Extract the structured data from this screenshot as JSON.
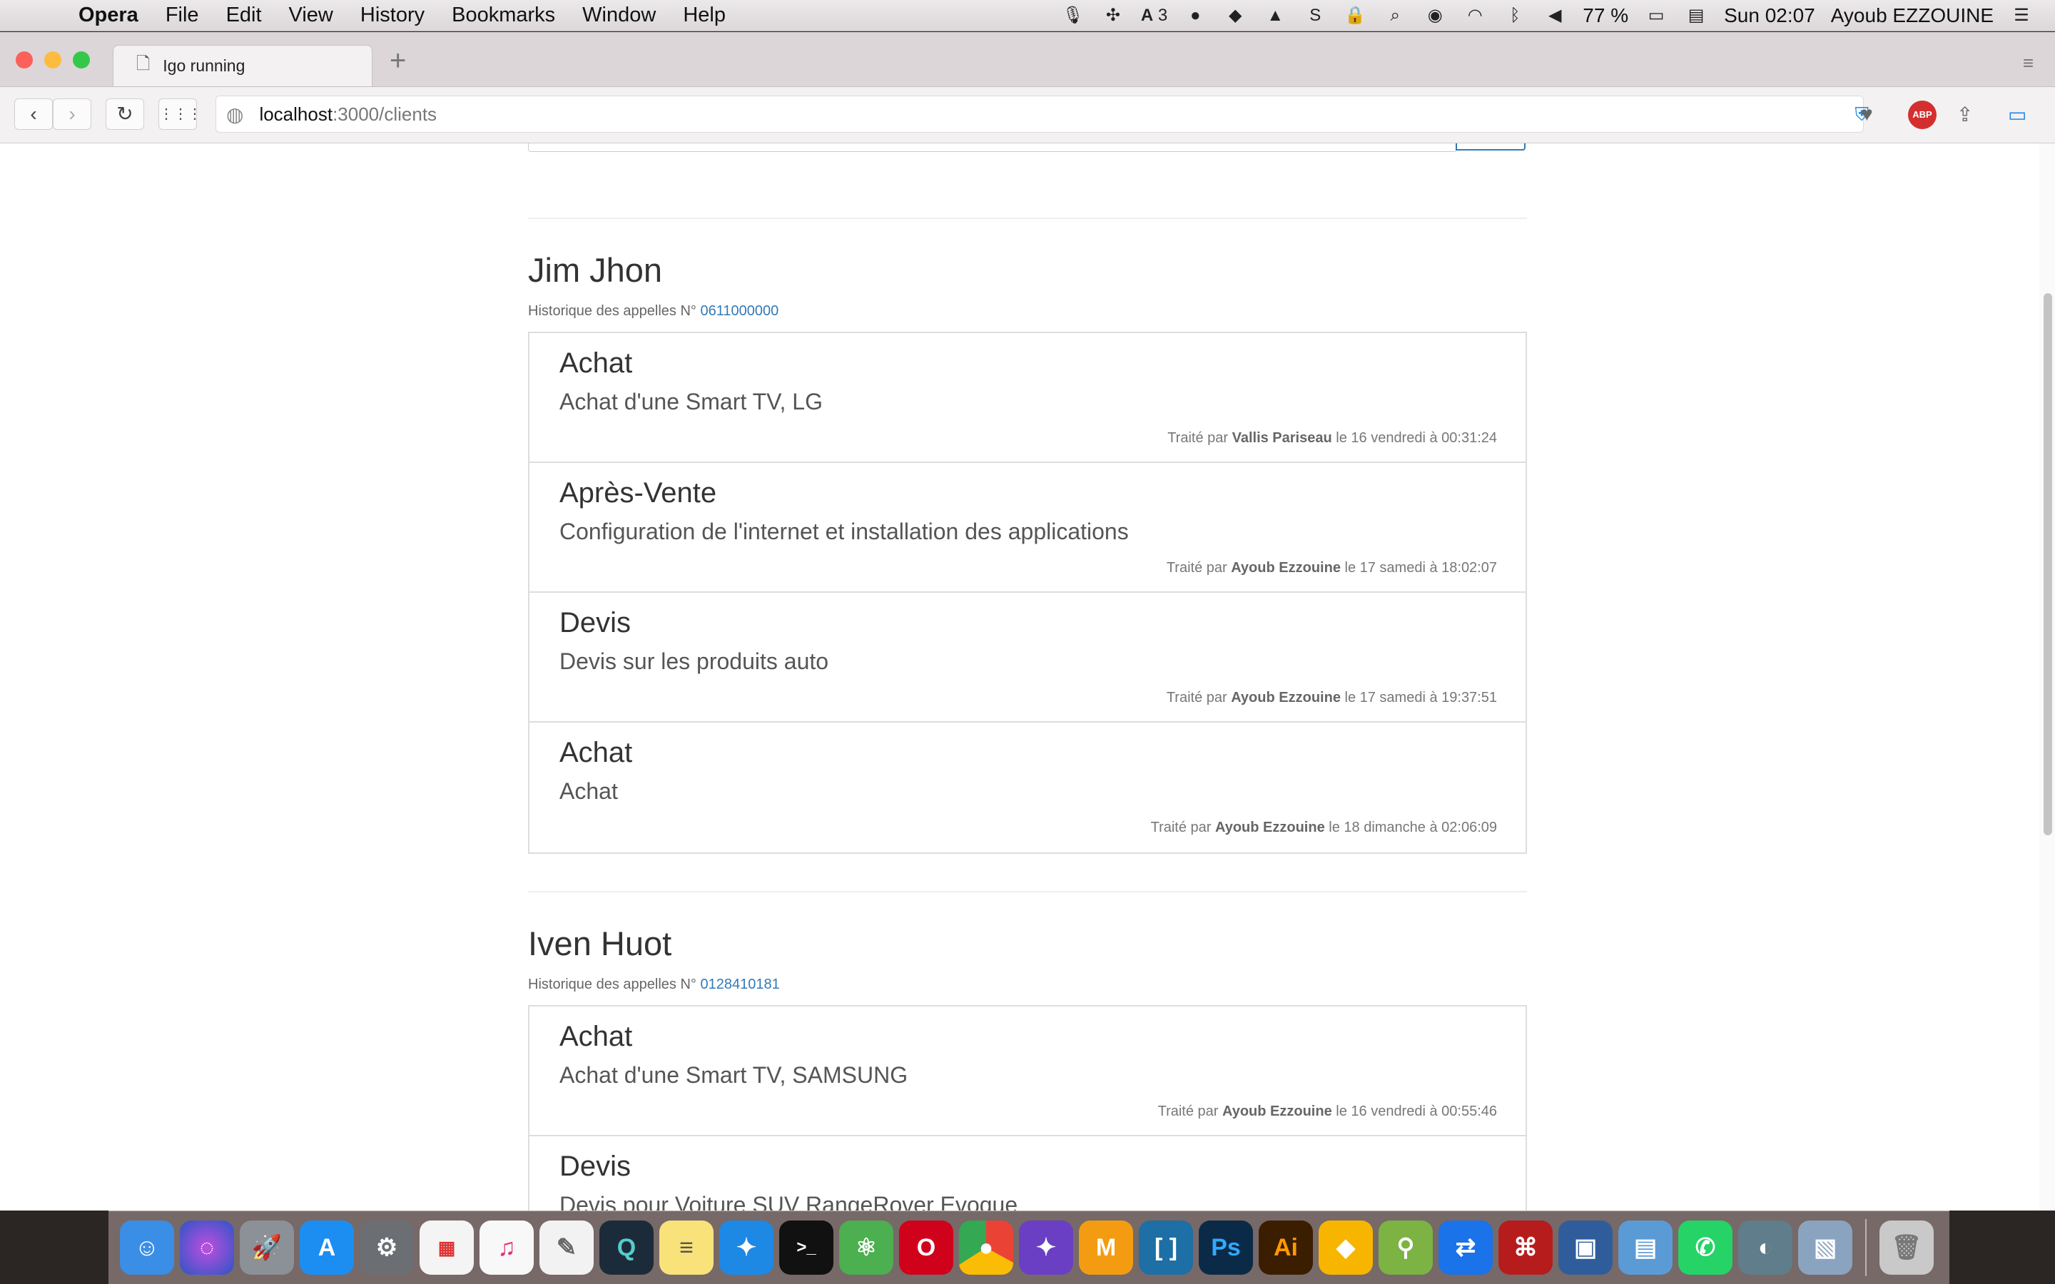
{
  "menubar": {
    "apple": "",
    "app": "Opera",
    "items": [
      "File",
      "Edit",
      "View",
      "History",
      "Bookmarks",
      "Window",
      "Help"
    ],
    "status": {
      "battery": "77 %",
      "clock": "Sun 02:07",
      "user": "Ayoub EZZOUINE",
      "adobe_count": "3"
    }
  },
  "browser": {
    "tab_title": "Igo running",
    "url_host": "localhost",
    "url_path": ":3000/clients",
    "abp_label": "ABP"
  },
  "clients": [
    {
      "name": "Jim Jhon",
      "history_label": "Historique des appelles N°",
      "phone": "0611000000",
      "calls": [
        {
          "type": "Achat",
          "description": "Achat d'une Smart TV, LG",
          "prefix": "Traité par",
          "agent": "Vallis Pariseau",
          "date": "le 16 vendredi à 00:31:24"
        },
        {
          "type": "Après-Vente",
          "description": "Configuration de l'internet et installation des applications",
          "prefix": "Traité par",
          "agent": "Ayoub Ezzouine",
          "date": "le 17 samedi à 18:02:07"
        },
        {
          "type": "Devis",
          "description": "Devis sur les produits auto",
          "prefix": "Traité par",
          "agent": "Ayoub Ezzouine",
          "date": "le 17 samedi à 19:37:51"
        },
        {
          "type": "Achat",
          "description": "Achat",
          "prefix": "Traité par",
          "agent": "Ayoub Ezzouine",
          "date": "le 18 dimanche à 02:06:09"
        }
      ]
    },
    {
      "name": "Iven Huot",
      "history_label": "Historique des appelles N°",
      "phone": "0128410181",
      "calls": [
        {
          "type": "Achat",
          "description": "Achat d'une Smart TV, SAMSUNG",
          "prefix": "Traité par",
          "agent": "Ayoub Ezzouine",
          "date": "le 16 vendredi à 00:55:46"
        },
        {
          "type": "Devis",
          "description": "Devis pour Voiture SUV RangeRover Evoque",
          "prefix": "",
          "agent": "",
          "date": ""
        }
      ]
    }
  ],
  "dock": {
    "icons": [
      "finder-icon",
      "siri-icon",
      "launchpad-icon",
      "app-store-icon",
      "system-preferences-icon",
      "launchpad-grid-icon",
      "itunes-icon",
      "textedit-icon",
      "quicktime-icon",
      "notes-icon",
      "safari-icon",
      "terminal-icon",
      "atom-icon",
      "opera-icon",
      "chrome-icon",
      "safari-tech-icon",
      "mamp-icon",
      "brackets-icon",
      "photoshop-icon",
      "illustrator-icon",
      "sketch-icon",
      "android-studio-icon",
      "teamviewer-icon",
      "acrobat-icon",
      "virtualbox-icon",
      "preview-icon",
      "whatsapp-icon",
      "sequel-pro-icon",
      "image-capture-icon",
      "trash-icon"
    ],
    "labels": {
      "photoshop": "Ps",
      "illustrator": "Ai"
    },
    "colors": {
      "finder": "#3a8ee6",
      "photoshop": "#0b2a47",
      "illustrator": "#3b1e00",
      "opera": "#d0021b",
      "whatsapp": "#25d366"
    }
  },
  "colors": {
    "link": "#337ab7",
    "border": "#dddddd",
    "text": "#333333"
  }
}
